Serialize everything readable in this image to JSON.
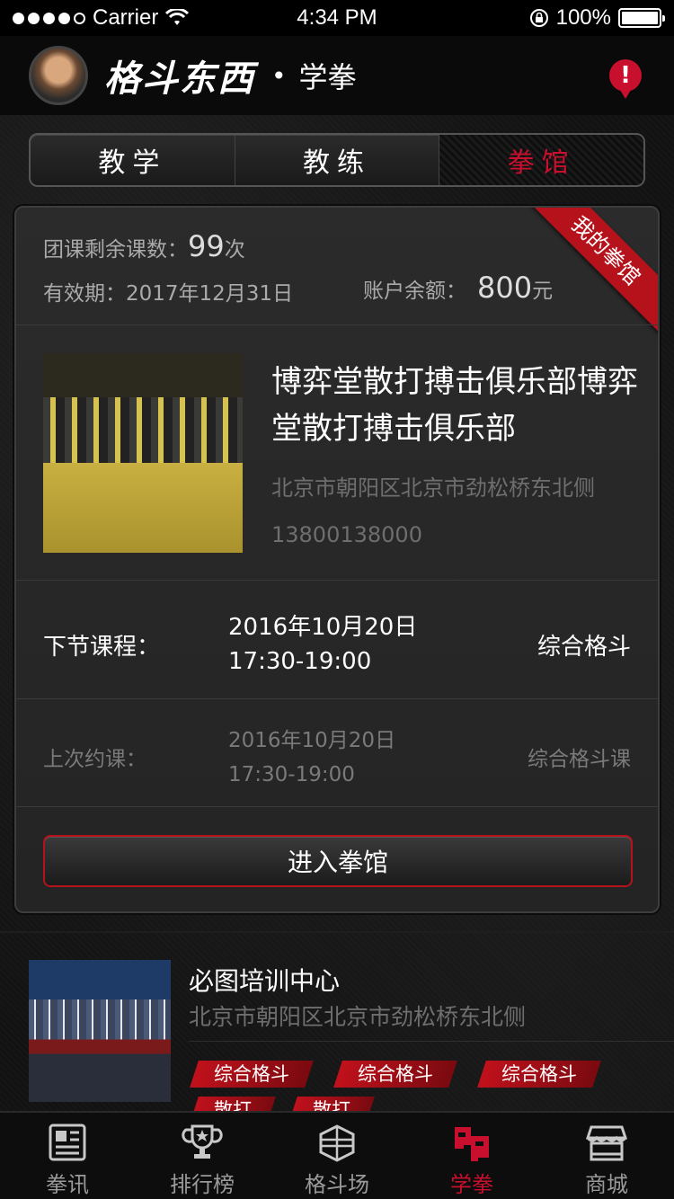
{
  "status_bar": {
    "carrier": "Carrier",
    "time": "4:34 PM",
    "battery": "100%"
  },
  "header": {
    "brand": "格斗东西",
    "separator": "•",
    "section": "学拳"
  },
  "tabs": [
    {
      "label": "教学",
      "active": false
    },
    {
      "label": "教练",
      "active": false
    },
    {
      "label": "拳馆",
      "active": true
    }
  ],
  "card": {
    "ribbon": "我的拳馆",
    "remaining_label": "团课剩余课数：",
    "remaining_count": "99",
    "remaining_unit": "次",
    "valid_until": "有效期：2017年12月31日",
    "balance_label": "账户余额：",
    "balance_amount": "800",
    "balance_unit": "元",
    "gym_name": "博弈堂散打搏击俱乐部博弈堂散打搏击俱乐部",
    "gym_address": "北京市朝阳区北京市劲松桥东北侧",
    "gym_phone": "13800138000",
    "next_label": "下节课程：",
    "next_date": "2016年10月20日",
    "next_time": "17:30-19:00",
    "next_type": "综合格斗",
    "last_label": "上次约课：",
    "last_date": "2016年10月20日",
    "last_time": "17:30-19:00",
    "last_type": "综合格斗课",
    "enter_button": "进入拳馆"
  },
  "list": [
    {
      "name": "必图培训中心",
      "address": "北京市朝阳区北京市劲松桥东北侧",
      "tags": [
        "综合格斗",
        "综合格斗",
        "综合格斗",
        "散打",
        "散打"
      ]
    }
  ],
  "tabbar": [
    {
      "label": "拳讯",
      "icon": "news-icon",
      "active": false
    },
    {
      "label": "排行榜",
      "icon": "trophy-icon",
      "active": false
    },
    {
      "label": "格斗场",
      "icon": "ring-icon",
      "active": false
    },
    {
      "label": "学拳",
      "icon": "boxing-glove-icon",
      "active": true
    },
    {
      "label": "商城",
      "icon": "store-icon",
      "active": false
    }
  ],
  "colors": {
    "accent": "#c8102e",
    "background": "#141414",
    "muted_text": "#6e6e6e"
  }
}
